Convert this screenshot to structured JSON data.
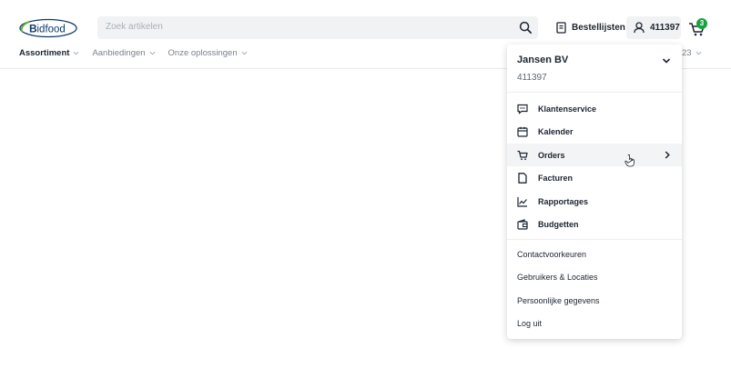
{
  "brand": {
    "logo_text": "Bidfood",
    "logo_color": "#0d3b66",
    "accent_color": "#5ab034"
  },
  "search": {
    "placeholder": "Zoek artikelen",
    "icon": "search-icon"
  },
  "header": {
    "order_lists_label": "Bestellijsten",
    "account_number": "411397",
    "cart_count": "3",
    "badge_color": "#18a23f"
  },
  "nav": {
    "items": [
      {
        "label": "Assortiment",
        "active": true
      },
      {
        "label": "Aanbiedingen",
        "active": false
      },
      {
        "label": "Onze oplossingen",
        "active": false
      }
    ],
    "right_partial": "23"
  },
  "account_menu": {
    "company_name": "Jansen BV",
    "account_number": "411397",
    "items": [
      {
        "label": "Klantenservice",
        "icon": "chat-icon"
      },
      {
        "label": "Kalender",
        "icon": "calendar-icon"
      },
      {
        "label": "Orders",
        "icon": "cart-icon",
        "has_submenu": true,
        "hovered": true
      },
      {
        "label": "Facturen",
        "icon": "document-icon"
      },
      {
        "label": "Rapportages",
        "icon": "chart-icon"
      },
      {
        "label": "Budgetten",
        "icon": "wallet-icon"
      }
    ],
    "links": [
      {
        "label": "Contactvoorkeuren"
      },
      {
        "label": "Gebruikers & Locaties"
      },
      {
        "label": "Persoonlijke gegevens"
      },
      {
        "label": "Log uit"
      }
    ]
  }
}
